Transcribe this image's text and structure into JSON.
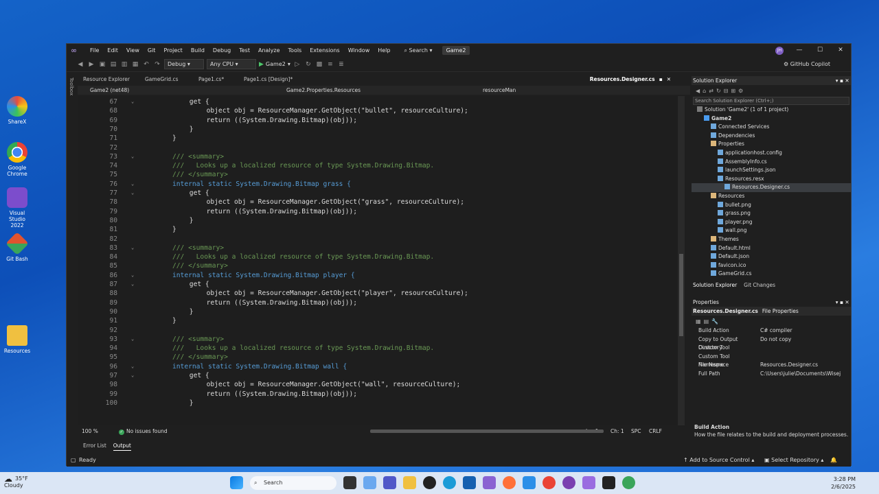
{
  "desktop": {
    "icons": [
      {
        "label": "ShareX",
        "color": "#3aa0e0"
      },
      {
        "label": "Google Chrome",
        "color": "#e8453c"
      },
      {
        "label": "Visual Studio 2022",
        "color": "#7c4dcc"
      },
      {
        "label": "Git Bash",
        "color": "#e0532f"
      },
      {
        "label": "Resources",
        "color": "#f0c040"
      }
    ]
  },
  "menu": {
    "items": [
      "File",
      "Edit",
      "View",
      "Git",
      "Project",
      "Build",
      "Debug",
      "Test",
      "Analyze",
      "Tools",
      "Extensions",
      "Window",
      "Help"
    ],
    "search": "Search",
    "project_badge": "Game2",
    "avatar": "JH"
  },
  "toolbar": {
    "config": "Debug",
    "platform": "Any CPU",
    "run_label": "Game2",
    "copilot": "GitHub Copilot"
  },
  "editor_tabs": [
    "Resource Explorer",
    "GameGrid.cs",
    "Page1.cs*",
    "Page1.cs [Design]*"
  ],
  "active_tab": "Resources.Designer.cs",
  "navbar": {
    "project": "Game2 (net48)",
    "class": "Game2.Properties.Resources",
    "member": "resourceMan"
  },
  "left_strip": "Toolbox",
  "code_lines": [
    {
      "n": "67",
      "html": "get {"
    },
    {
      "n": "68",
      "html": "object obj = ResourceManager.GetObject(\"bullet\", resourceCulture);"
    },
    {
      "n": "69",
      "html": "return ((System.Drawing.Bitmap)(obj));"
    },
    {
      "n": "70",
      "html": "}"
    },
    {
      "n": "71",
      "html": "}"
    },
    {
      "n": "72",
      "html": ""
    },
    {
      "n": "73",
      "html": "/// <summary>"
    },
    {
      "n": "74",
      "html": "///   Looks up a localized resource of type System.Drawing.Bitmap."
    },
    {
      "n": "75",
      "html": "/// </summary>"
    },
    {
      "n": "76",
      "html": "internal static System.Drawing.Bitmap grass {"
    },
    {
      "n": "77",
      "html": "get {"
    },
    {
      "n": "78",
      "html": "object obj = ResourceManager.GetObject(\"grass\", resourceCulture);"
    },
    {
      "n": "79",
      "html": "return ((System.Drawing.Bitmap)(obj));"
    },
    {
      "n": "80",
      "html": "}"
    },
    {
      "n": "81",
      "html": "}"
    },
    {
      "n": "82",
      "html": ""
    },
    {
      "n": "83",
      "html": "/// <summary>"
    },
    {
      "n": "84",
      "html": "///   Looks up a localized resource of type System.Drawing.Bitmap."
    },
    {
      "n": "85",
      "html": "/// </summary>"
    },
    {
      "n": "86",
      "html": "internal static System.Drawing.Bitmap player {"
    },
    {
      "n": "87",
      "html": "get {"
    },
    {
      "n": "88",
      "html": "object obj = ResourceManager.GetObject(\"player\", resourceCulture);"
    },
    {
      "n": "89",
      "html": "return ((System.Drawing.Bitmap)(obj));"
    },
    {
      "n": "90",
      "html": "}"
    },
    {
      "n": "91",
      "html": "}"
    },
    {
      "n": "92",
      "html": ""
    },
    {
      "n": "93",
      "html": "/// <summary>"
    },
    {
      "n": "94",
      "html": "///   Looks up a localized resource of type System.Drawing.Bitmap."
    },
    {
      "n": "95",
      "html": "/// </summary>"
    },
    {
      "n": "96",
      "html": "internal static System.Drawing.Bitmap wall {"
    },
    {
      "n": "97",
      "html": "get {"
    },
    {
      "n": "98",
      "html": "object obj = ResourceManager.GetObject(\"wall\", resourceCulture);"
    },
    {
      "n": "99",
      "html": "return ((System.Drawing.Bitmap)(obj));"
    },
    {
      "n": "100",
      "html": "}"
    }
  ],
  "editor_status": {
    "zoom": "100 %",
    "issues": "No issues found",
    "ln": "Ln: 1",
    "ch": "Ch: 1",
    "spc": "SPC",
    "crlf": "CRLF"
  },
  "bottom_tabs": [
    "Error List",
    "Output"
  ],
  "solution_explorer": {
    "title": "Solution Explorer",
    "search_placeholder": "Search Solution Explorer (Ctrl+;)",
    "items": [
      {
        "label": "Solution 'Game2' (1 of 1 project)",
        "depth": 0
      },
      {
        "label": "Game2",
        "depth": 1
      },
      {
        "label": "Connected Services",
        "depth": 2
      },
      {
        "label": "Dependencies",
        "depth": 2
      },
      {
        "label": "Properties",
        "depth": 2
      },
      {
        "label": "applicationhost.config",
        "depth": 3
      },
      {
        "label": "AssemblyInfo.cs",
        "depth": 3
      },
      {
        "label": "launchSettings.json",
        "depth": 3
      },
      {
        "label": "Resources.resx",
        "depth": 3
      },
      {
        "label": "Resources.Designer.cs",
        "depth": 4
      },
      {
        "label": "Resources",
        "depth": 2
      },
      {
        "label": "bullet.png",
        "depth": 3
      },
      {
        "label": "grass.png",
        "depth": 3
      },
      {
        "label": "player.png",
        "depth": 3
      },
      {
        "label": "wall.png",
        "depth": 3
      },
      {
        "label": "Themes",
        "depth": 2
      },
      {
        "label": "Default.html",
        "depth": 2
      },
      {
        "label": "Default.json",
        "depth": 2
      },
      {
        "label": "favicon.ico",
        "depth": 2
      },
      {
        "label": "GameGrid.cs",
        "depth": 2
      }
    ],
    "footer_tabs": [
      "Solution Explorer",
      "Git Changes"
    ]
  },
  "properties": {
    "title": "Properties",
    "subject": "Resources.Designer.cs",
    "subject_type": "File Properties",
    "rows": [
      {
        "k": "Build Action",
        "v": "C# compiler"
      },
      {
        "k": "Copy to Output Directory",
        "v": "Do not copy"
      },
      {
        "k": "Custom Tool",
        "v": ""
      },
      {
        "k": "Custom Tool Namespace",
        "v": ""
      },
      {
        "k": "File Name",
        "v": "Resources.Designer.cs"
      },
      {
        "k": "Full Path",
        "v": "C:\\Users\\julie\\Documents\\Wisej"
      }
    ],
    "desc_title": "Build Action",
    "desc_text": "How the file relates to the build and deployment processes."
  },
  "status_bar": {
    "ready": "Ready",
    "source_control": "Add to Source Control",
    "repo": "Select Repository"
  },
  "taskbar": {
    "temp": "35°F",
    "condition": "Cloudy",
    "search": "Search",
    "time": "3:28 PM",
    "date": "2/6/2025"
  }
}
